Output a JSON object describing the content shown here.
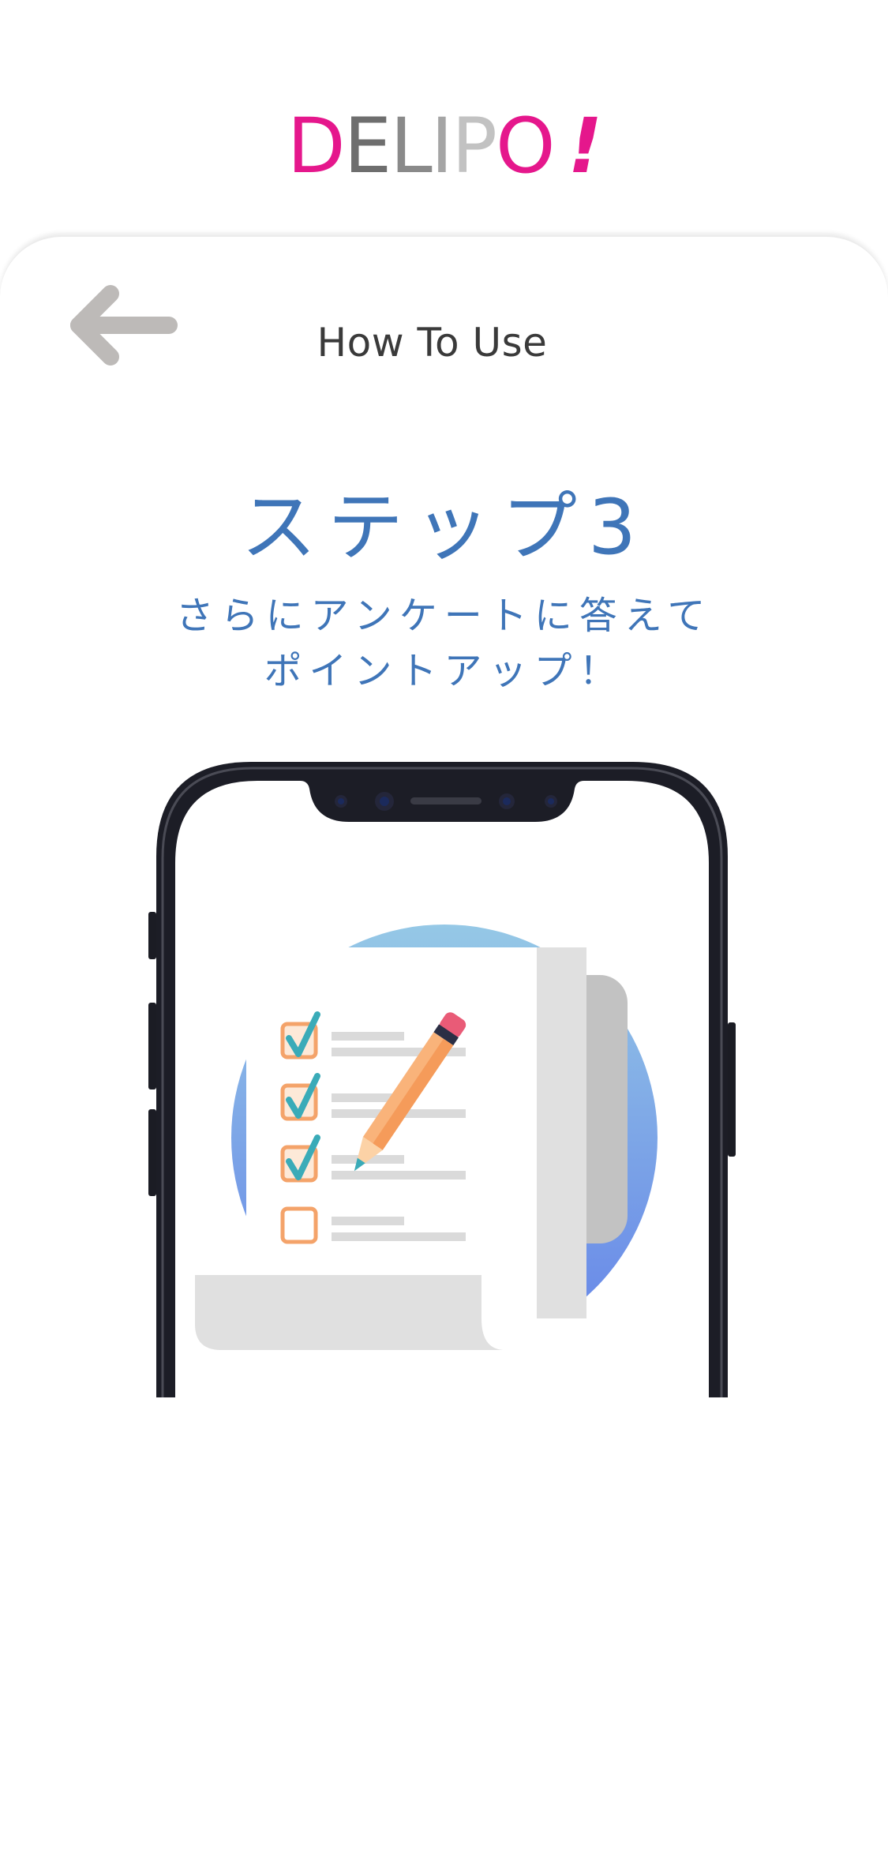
{
  "logo": {
    "letters": [
      {
        "char": "D",
        "color": "#e5178c"
      },
      {
        "char": "E",
        "color": "#6e6e6e"
      },
      {
        "char": "L",
        "color": "#8a8a8a"
      },
      {
        "char": "I",
        "color": "#a5a5a5"
      },
      {
        "char": "P",
        "color": "#c2c2c2"
      },
      {
        "char": "O",
        "color": "#e5178c"
      },
      {
        "char": "!",
        "color": "#e5178c"
      }
    ]
  },
  "header": {
    "back_icon": "arrow-left-icon",
    "title": "How To Use"
  },
  "step": {
    "title": "ステップ3",
    "description_line1": "さらにアンケートに答えて",
    "description_line2": "ポイントアップ！"
  },
  "illustration": {
    "icon": "survey-checklist-icon",
    "checked_items": 3,
    "unchecked_items": 1
  },
  "colors": {
    "accent_blue": "#3f75b8",
    "brand_pink": "#e5178c",
    "checkbox_orange": "#f4a36a",
    "check_teal": "#3aabb8"
  }
}
